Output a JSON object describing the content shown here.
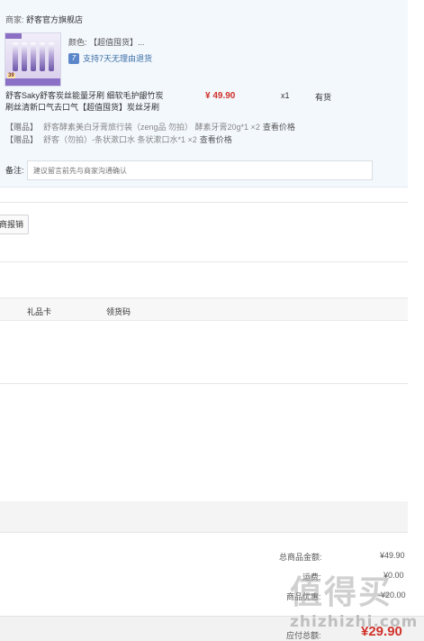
{
  "shop": {
    "merchant_label": "商家:",
    "merchant_name": "舒客官方旗舰店",
    "thumb_badge": "39",
    "color_line": "颜色: 【超值囤货】...",
    "return_icon": "7",
    "return_text": "支持7天无理由退货",
    "product_title": "舒客Saky舒客炭丝能量牙刷 细软毛护龈竹炭刷丝清新口气去口气【超值囤货】炭丝牙刷",
    "price": "¥ 49.90",
    "qty": "x1",
    "stock": "有货",
    "gifts": [
      {
        "tag": "【赠品】",
        "name": "舒客酵素美白牙膏旅行装（zeng品 勿拍） 酵素牙膏20g*1 ×2",
        "link": "查看价格"
      },
      {
        "tag": "【赠品】",
        "name": "舒客（勿拍）-条状漱口水 条状漱口水*1 ×2",
        "link": "查看价格"
      }
    ],
    "note_label": "备注:",
    "note_placeholder": "建议留言前先与商家沟通确认"
  },
  "partial_button": "商报销",
  "tabs": {
    "gift_card": "礼品卡",
    "coupon_code": "领货码"
  },
  "summary": {
    "total_label": "总商品金额:",
    "total_value": "¥49.90",
    "row2_label": "运费:",
    "row2_value": "¥0.00",
    "row3_label": "商品优惠:",
    "row3_value": "-¥20.00"
  },
  "pay": {
    "label": "应付总额:",
    "value": "¥29.90"
  },
  "watermark": {
    "glyphs": "值得买",
    "text": "zhizhizhi.com"
  },
  "colors": {
    "price_red": "#d0322b",
    "box_bg": "#f3f8fd",
    "link_blue": "#3a6ea5"
  }
}
